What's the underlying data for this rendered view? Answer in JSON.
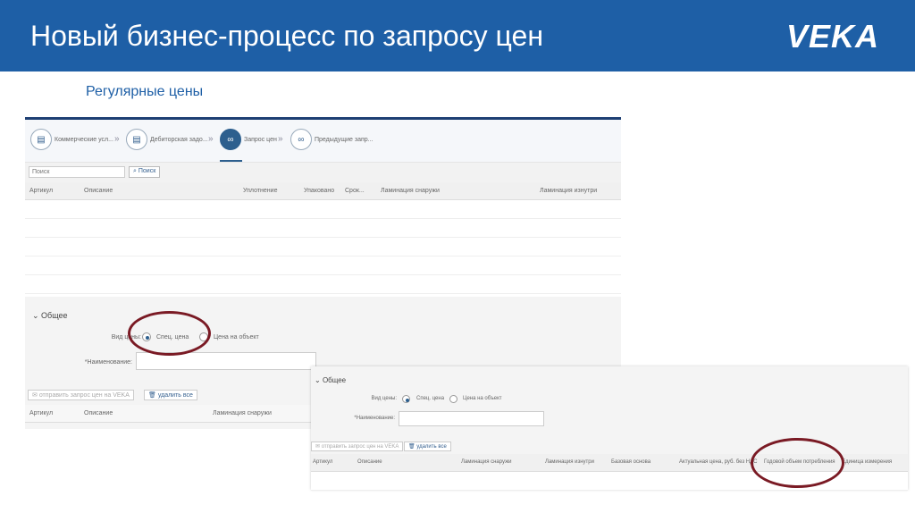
{
  "header": {
    "title": "Новый бизнес-процесс по запросу цен",
    "logo": "VEKA"
  },
  "subtitle": "Регулярные цены",
  "screen1": {
    "steps": [
      "Коммерческие усл...",
      "Дебиторская задо...",
      "Запрос цен",
      "Предыдущие запр..."
    ],
    "search_placeholder": "Поиск",
    "search_button": "Поиск",
    "columns": [
      "Артикул",
      "Описание",
      "Уплотнение",
      "Упаковано",
      "Срок...",
      "Ламинация снаружи",
      "Ламинация изнутри"
    ],
    "section": "Общее",
    "price_type_label": "Вид цены:",
    "option1": "Спец. цена",
    "option2": "Цена на объект",
    "name_label": "*Наименование:",
    "send_button": "отправить запрос цен на VEKA",
    "delete_button": "удалить все",
    "columns2": [
      "Артикул",
      "Описание",
      "Ламинация снаружи"
    ]
  },
  "screen2": {
    "section": "Общее",
    "price_type_label": "Вид цены:",
    "option1": "Спец. цена",
    "option2": "Цена на объект",
    "name_label": "*Наименование:",
    "send_button": "отправить запрос цен на VEKA",
    "delete_button": "удалить все",
    "columns": [
      "Артикул",
      "Описание",
      "Ламинация снаружи",
      "Ламинация изнутри",
      "Базовая основа",
      "Актуальная цена, руб. без НДС",
      "Годовой объем потребления",
      "Единица измерения"
    ]
  }
}
